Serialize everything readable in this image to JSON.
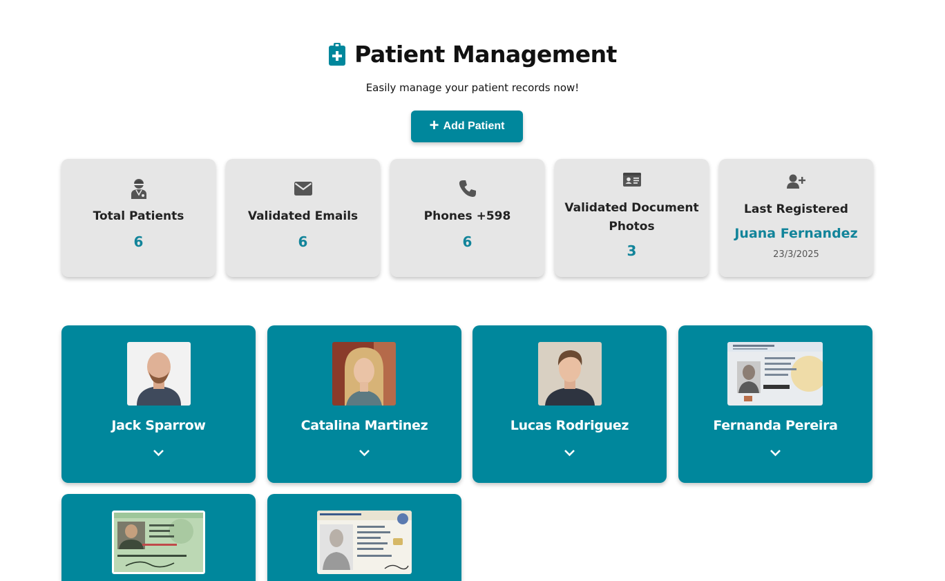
{
  "header": {
    "title": "Patient Management",
    "subtitle": "Easily manage your patient records now!",
    "icon": "clipboard-medical-icon",
    "add_button_label": "Add Patient"
  },
  "stats": [
    {
      "icon": "user-doctor-icon",
      "label": "Total Patients",
      "value": "6"
    },
    {
      "icon": "envelope-icon",
      "label": "Validated Emails",
      "value": "6"
    },
    {
      "icon": "phone-icon",
      "label": "Phones +598",
      "value": "6"
    },
    {
      "icon": "id-card-icon",
      "label": "Validated Document Photos",
      "value": "3"
    },
    {
      "icon": "user-plus-icon",
      "label": "Last Registered",
      "name": "Juana Fernandez",
      "date": "23/3/2025"
    }
  ],
  "patients": [
    {
      "name": "Jack Sparrow",
      "photo": "portrait"
    },
    {
      "name": "Catalina Martinez",
      "photo": "portrait"
    },
    {
      "name": "Lucas Rodriguez",
      "photo": "portrait"
    },
    {
      "name": "Fernanda Pereira",
      "photo": "id-document"
    },
    {
      "name": "",
      "photo": "id-document"
    },
    {
      "name": "",
      "photo": "id-document"
    }
  ],
  "colors": {
    "accent": "#00879c",
    "stat_value": "#12849a",
    "stat_card_bg": "#e6e6e6",
    "icon_gray": "#555555"
  }
}
